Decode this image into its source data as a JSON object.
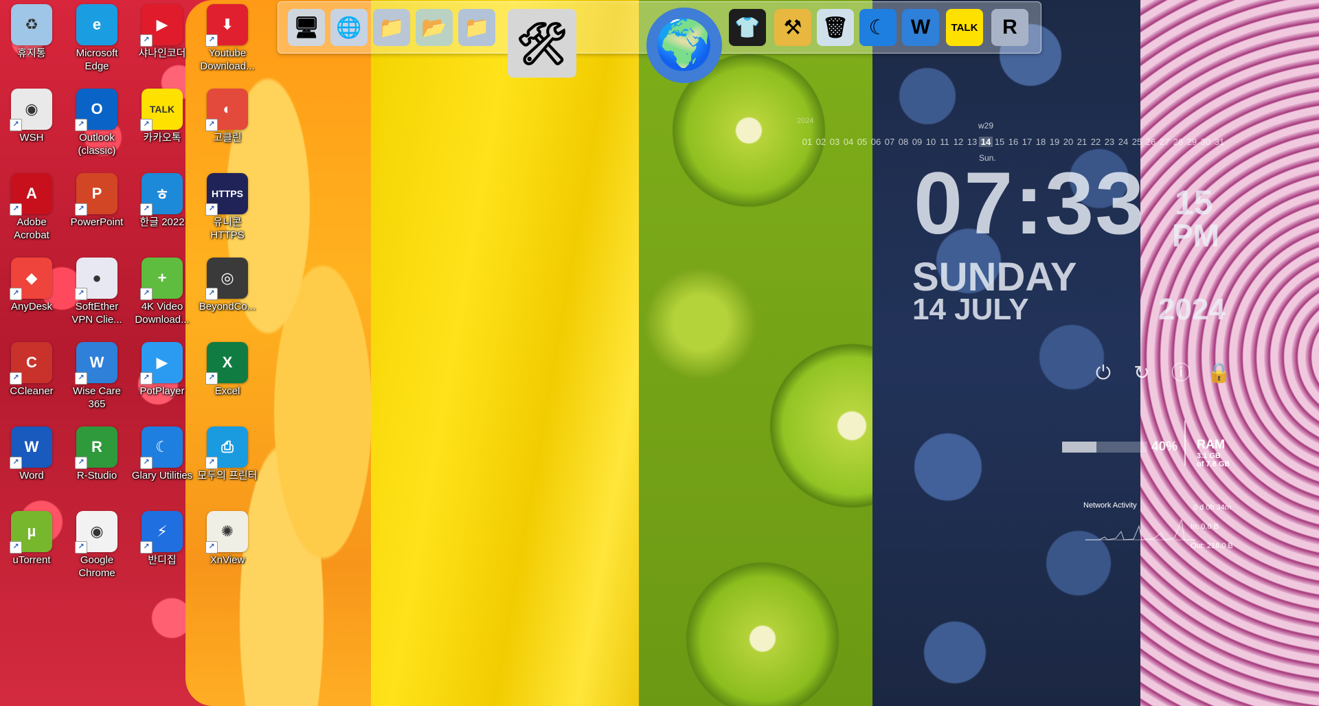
{
  "desktop": {
    "icons": [
      {
        "label": "휴지통",
        "icon": "recycle-bin-icon",
        "color": "#9fc6e6",
        "glyph": "♻"
      },
      {
        "label": "Microsoft Edge",
        "icon": "edge-icon",
        "color": "#1b9de2",
        "glyph": "e"
      },
      {
        "label": "샤나인코더",
        "icon": "shana-encoder-icon",
        "color": "#e01b2b",
        "glyph": "▶"
      },
      {
        "label": "Youtube Download...",
        "icon": "youtube-downloader-icon",
        "color": "#e0202e",
        "glyph": "⬇"
      },
      {
        "label": "WSH",
        "icon": "wsh-file-icon",
        "color": "#e9e9e9",
        "glyph": "◉"
      },
      {
        "label": "Outlook (classic)",
        "icon": "outlook-icon",
        "color": "#0a64c8",
        "glyph": "O"
      },
      {
        "label": "카카오톡",
        "icon": "kakaotalk-icon",
        "color": "#ffe100",
        "glyph": "TALK"
      },
      {
        "label": "고클린",
        "icon": "goclean-icon",
        "color": "#e34a3b",
        "glyph": "◐"
      },
      {
        "label": "Adobe Acrobat",
        "icon": "adobe-acrobat-icon",
        "color": "#c8101c",
        "glyph": "A"
      },
      {
        "label": "PowerPoint",
        "icon": "powerpoint-icon",
        "color": "#d24625",
        "glyph": "P"
      },
      {
        "label": "한글 2022",
        "icon": "hangul-2022-icon",
        "color": "#1c8ad8",
        "glyph": "ㅎ"
      },
      {
        "label": "유니콘 HTTPS",
        "icon": "unicorn-https-icon",
        "color": "#1f2358",
        "glyph": "HTTPS"
      },
      {
        "label": "AnyDesk",
        "icon": "anydesk-icon",
        "color": "#ef443b",
        "glyph": "◆"
      },
      {
        "label": "SoftEther VPN Clie...",
        "icon": "softether-vpn-icon",
        "color": "#e8e8f2",
        "glyph": "●"
      },
      {
        "label": "4K Video Download...",
        "icon": "4k-video-downloader-icon",
        "color": "#5ebd3e",
        "glyph": "+"
      },
      {
        "label": "BeyondCo...",
        "icon": "beyond-compare-icon",
        "color": "#3a3a3a",
        "glyph": "◎"
      },
      {
        "label": "CCleaner",
        "icon": "ccleaner-icon",
        "color": "#c9322b",
        "glyph": "C"
      },
      {
        "label": "Wise Care 365",
        "icon": "wise-care-icon",
        "color": "#2f80d8",
        "glyph": "W"
      },
      {
        "label": "PotPlayer",
        "icon": "potplayer-icon",
        "color": "#2b9bf1",
        "glyph": "▶"
      },
      {
        "label": "Excel",
        "icon": "excel-icon",
        "color": "#107c41",
        "glyph": "X"
      },
      {
        "label": "Word",
        "icon": "word-icon",
        "color": "#185abd",
        "glyph": "W"
      },
      {
        "label": "R-Studio",
        "icon": "r-studio-icon",
        "color": "#2f9a3c",
        "glyph": "R"
      },
      {
        "label": "Glary Utilities",
        "icon": "glary-utilities-icon",
        "color": "#1e7fe0",
        "glyph": "☾"
      },
      {
        "label": "모두의 프린터",
        "icon": "modu-printer-icon",
        "color": "#1a9be0",
        "glyph": "⎙"
      },
      {
        "label": "uTorrent",
        "icon": "utorrent-icon",
        "color": "#77b72d",
        "glyph": "µ"
      },
      {
        "label": "Google Chrome",
        "icon": "chrome-icon",
        "color": "#f2f2f2",
        "glyph": "◉"
      },
      {
        "label": "반디집",
        "icon": "bandizip-icon",
        "color": "#1f6fe0",
        "glyph": "⚡"
      },
      {
        "label": "XnView",
        "icon": "xnview-icon",
        "color": "#f0efe6",
        "glyph": "✺"
      }
    ]
  },
  "dock": {
    "items": [
      {
        "icon": "computer-icon",
        "glyph": "🖥",
        "color": "#d0d6de"
      },
      {
        "icon": "network-globe-icon",
        "glyph": "🌐",
        "color": "#c7d3e3"
      },
      {
        "icon": "folder-icon",
        "glyph": "📁",
        "color": "#b9c6d6"
      },
      {
        "icon": "green-folder-icon",
        "glyph": "📂",
        "color": "#b9d2c3"
      },
      {
        "icon": "blue-folder-icon",
        "glyph": "📁",
        "color": "#b2c3d8"
      },
      {
        "icon": "system-tools-icon",
        "glyph": "🛠",
        "color": "#d6d6d6"
      },
      {
        "icon": "internet-globe-icon",
        "glyph": "🌍",
        "color": "#3f7dd6"
      },
      {
        "icon": "tshirt-icon",
        "glyph": "👕",
        "color": "#1d1d1d"
      },
      {
        "icon": "hammer-tool-icon",
        "glyph": "⚒",
        "color": "#e7b73f"
      },
      {
        "icon": "recycle-bin-icon",
        "glyph": "🗑",
        "color": "#cfe0ea"
      },
      {
        "icon": "glary-utilities-icon",
        "glyph": "☾",
        "color": "#1e7fe0"
      },
      {
        "icon": "wise-care-icon",
        "glyph": "W",
        "color": "#2f80d8"
      },
      {
        "icon": "kakaotalk-icon",
        "glyph": "TALK",
        "color": "#ffe100"
      },
      {
        "icon": "r-studio-icon",
        "glyph": "R",
        "color": "#a9b3c7"
      }
    ]
  },
  "calendar": {
    "year": "2024",
    "week": "w29",
    "days": [
      "01",
      "02",
      "03",
      "04",
      "05",
      "06",
      "07",
      "08",
      "09",
      "10",
      "11",
      "12",
      "13",
      "14",
      "15",
      "16",
      "17",
      "18",
      "19",
      "20",
      "21",
      "22",
      "23",
      "24",
      "25",
      "26",
      "27",
      "28",
      "29",
      "30",
      "31"
    ],
    "today_index": 13,
    "day_of_week": "Sun."
  },
  "clock": {
    "time": "07:33",
    "seconds": "15",
    "ampm": "PM",
    "day": "SUNDAY",
    "date": "14 JULY",
    "year": "2024"
  },
  "power": {
    "buttons": [
      {
        "name": "power-icon",
        "glyph": "⏻"
      },
      {
        "name": "restart-icon",
        "glyph": "↻"
      },
      {
        "name": "shutdown-icon",
        "glyph": "ⓘ"
      },
      {
        "name": "lock-icon",
        "glyph": "🔒"
      }
    ]
  },
  "system": {
    "ram_percent": 40,
    "ram_percent_label": "40%",
    "ram_label": "RAM",
    "ram_used": "3.1 GB",
    "ram_total": "of 7.8 GB",
    "network_title": "Network Activity",
    "uptime": "0 d 0h 34m",
    "net_in": "In: 0.0 B",
    "net_out": "Out: 218.0 B"
  }
}
